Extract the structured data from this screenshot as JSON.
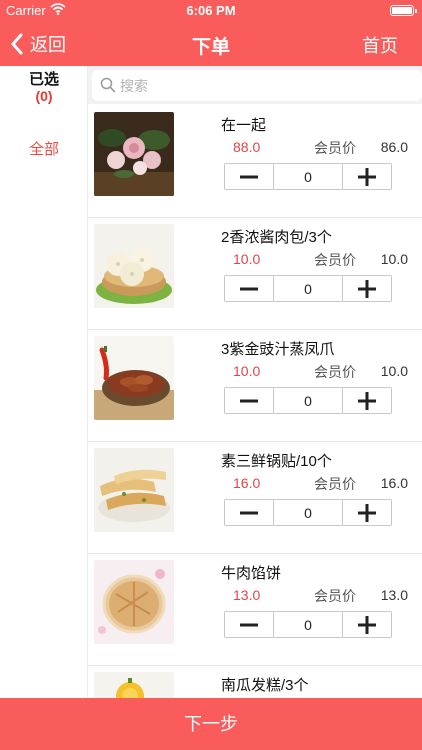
{
  "status_bar": {
    "carrier": "Carrier",
    "time": "6:06 PM"
  },
  "nav": {
    "back_label": "返回",
    "title": "下单",
    "home_label": "首页"
  },
  "sidebar": {
    "selected_title": "已选",
    "selected_count": "(0)",
    "category_all": "全部"
  },
  "search": {
    "placeholder": "搜索",
    "value": ""
  },
  "items": [
    {
      "name": "在一起",
      "price": "88.0",
      "member_label": "会员价",
      "member_price": "86.0",
      "quantity": "0",
      "image": "flower-bouquet-photo"
    },
    {
      "name": "2香浓酱肉包/3个",
      "price": "10.0",
      "member_label": "会员价",
      "member_price": "10.0",
      "quantity": "0",
      "image": "steamed-buns-photo"
    },
    {
      "name": "3紫金豉汁蒸凤爪",
      "price": "10.0",
      "member_label": "会员价",
      "member_price": "10.0",
      "quantity": "0",
      "image": "chicken-feet-photo"
    },
    {
      "name": "素三鲜锅贴/10个",
      "price": "16.0",
      "member_label": "会员价",
      "member_price": "16.0",
      "quantity": "0",
      "image": "potstickers-photo"
    },
    {
      "name": "牛肉馅饼",
      "price": "13.0",
      "member_label": "会员价",
      "member_price": "13.0",
      "quantity": "0",
      "image": "beef-pie-photo"
    },
    {
      "name": "南瓜发糕/3个",
      "price": "",
      "member_label": "",
      "member_price": "",
      "quantity": "",
      "image": "pumpkin-cake-photo"
    }
  ],
  "bottom": {
    "next_label": "下一步"
  },
  "colors": {
    "accent": "#fa5c5c",
    "price": "#e04545",
    "selected_count": "#e8382f"
  }
}
